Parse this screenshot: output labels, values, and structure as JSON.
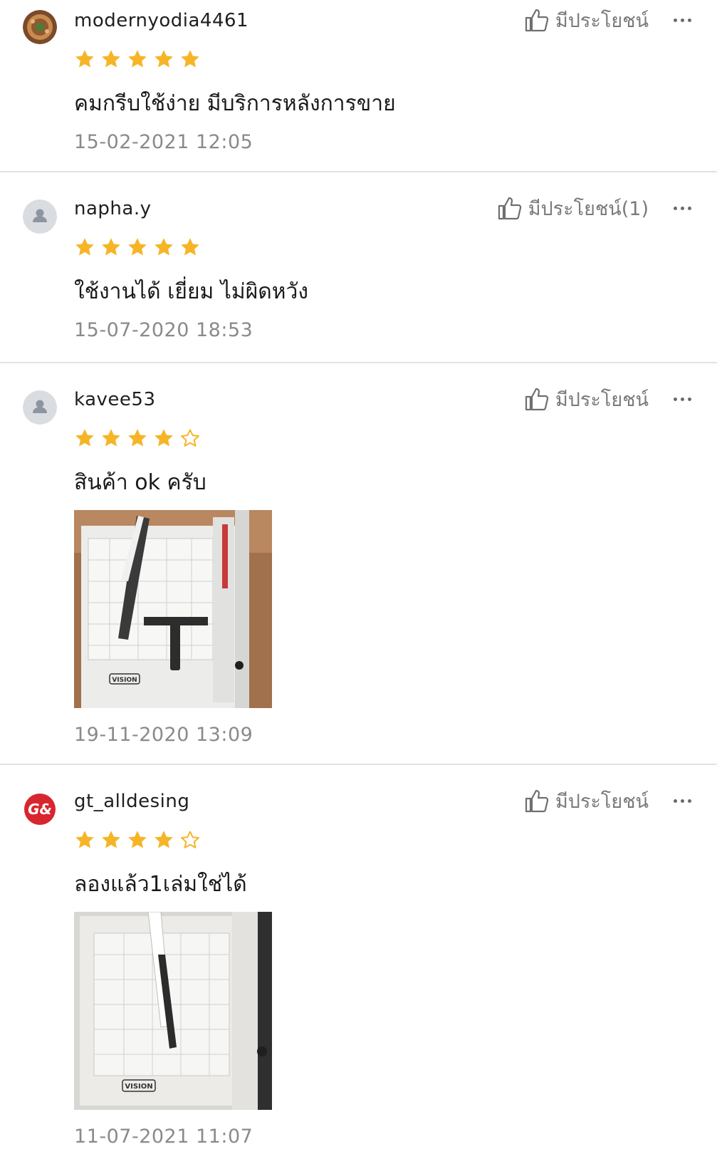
{
  "colors": {
    "star": "#f6b527",
    "star_empty": "#f6b527",
    "text_secondary": "#8a8a8a",
    "divider": "#e3e3e3"
  },
  "helpful_icon": "thumbs-up-icon",
  "more_icon": "more-options-icon",
  "reviews": [
    {
      "username": "modernyodia4461",
      "rating": 5,
      "comment": "คมกรีบใช้ง่าย มีบริการหลังการขาย",
      "time": "15-02-2021 12:05",
      "helpful_label": "มีประโยชน์"
    },
    {
      "username": "napha.y",
      "rating": 5,
      "comment": "ใช้งานได้ เยี่ยม ไม่ผิดหวัง",
      "time": "15-07-2020 18:53",
      "helpful_label": "มีประโยชน์(1)"
    },
    {
      "username": "kavee53",
      "rating": 4,
      "comment": "สินค้า ok ครับ",
      "time": "19-11-2020 13:09",
      "helpful_label": "มีประโยชน์",
      "photo_brand": "VISION"
    },
    {
      "username": "gt_alldesing",
      "rating": 4,
      "comment": "ลองแล้ว1เล่มใช่ได้",
      "time": "11-07-2021 11:07",
      "helpful_label": "มีประโยชน์",
      "photo_brand": "VISION"
    }
  ]
}
